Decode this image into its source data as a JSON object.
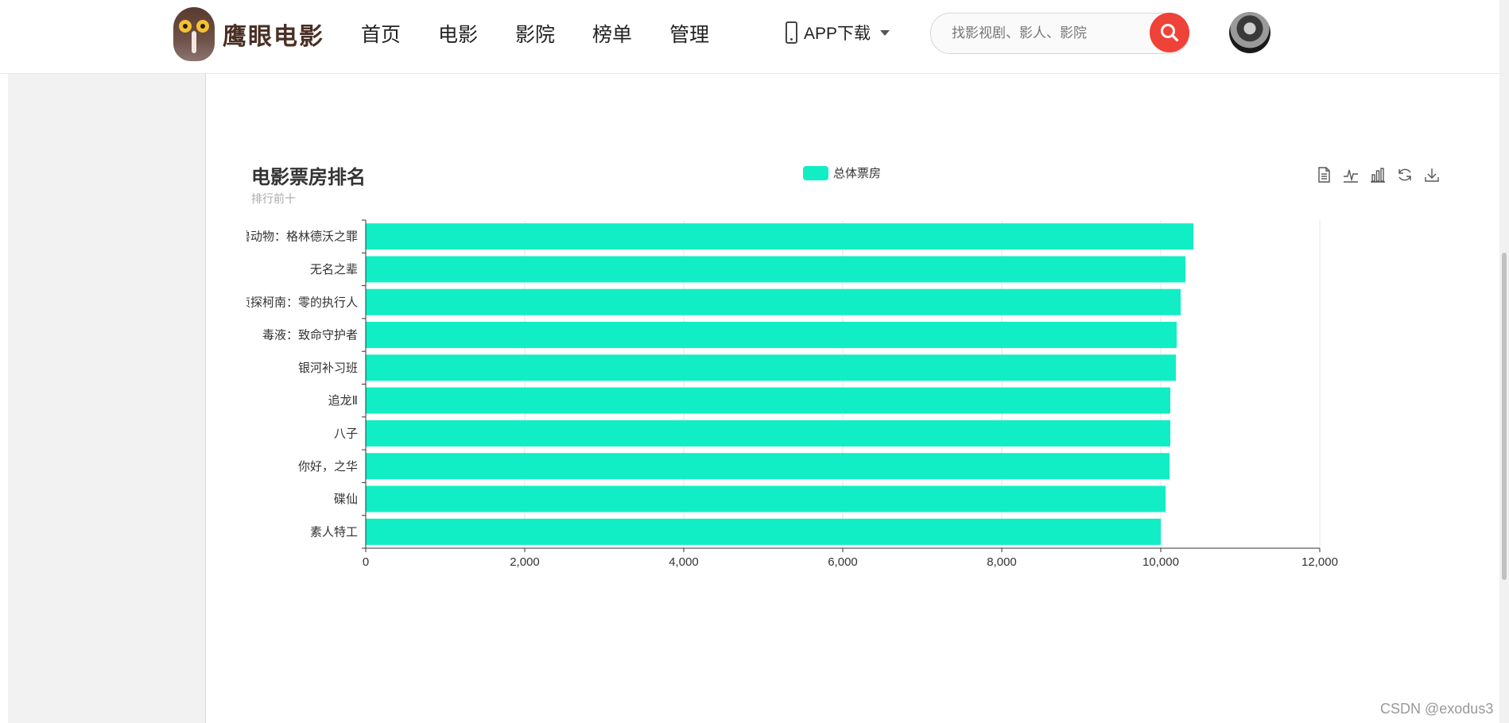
{
  "header": {
    "logo_text": "鹰眼电影",
    "nav": [
      "首页",
      "电影",
      "影院",
      "榜单",
      "管理"
    ],
    "app_download": "APP下载",
    "search_placeholder": "找影视剧、影人、影院"
  },
  "toolbox": [
    "data-view-icon",
    "line-chart-icon",
    "bar-chart-icon",
    "restore-icon",
    "download-icon"
  ],
  "colors": {
    "accent": "#ef4238",
    "bar": "#11eec5"
  },
  "chart_data": {
    "type": "bar",
    "orientation": "horizontal",
    "title": "电影票房排名",
    "subtitle": "排行前十",
    "categories": [
      "猛兽动物：格林德沃之罪",
      "无名之辈",
      "名侦探柯南：零的执行人",
      "毒液：致命守护者",
      "银河补习班",
      "追龙Ⅱ",
      "八子",
      "你好，之华",
      "碟仙",
      "素人特工"
    ],
    "series": [
      {
        "name": "总体票房",
        "values": [
          10410,
          10310,
          10250,
          10200,
          10190,
          10120,
          10120,
          10110,
          10060,
          10000
        ]
      }
    ],
    "xlim": [
      0,
      12000
    ],
    "xticks": [
      "0",
      "2,000",
      "4,000",
      "6,000",
      "8,000",
      "10,000",
      "12,000"
    ],
    "grid": true,
    "legend_position": "top-center"
  },
  "watermark": "CSDN @exodus3"
}
